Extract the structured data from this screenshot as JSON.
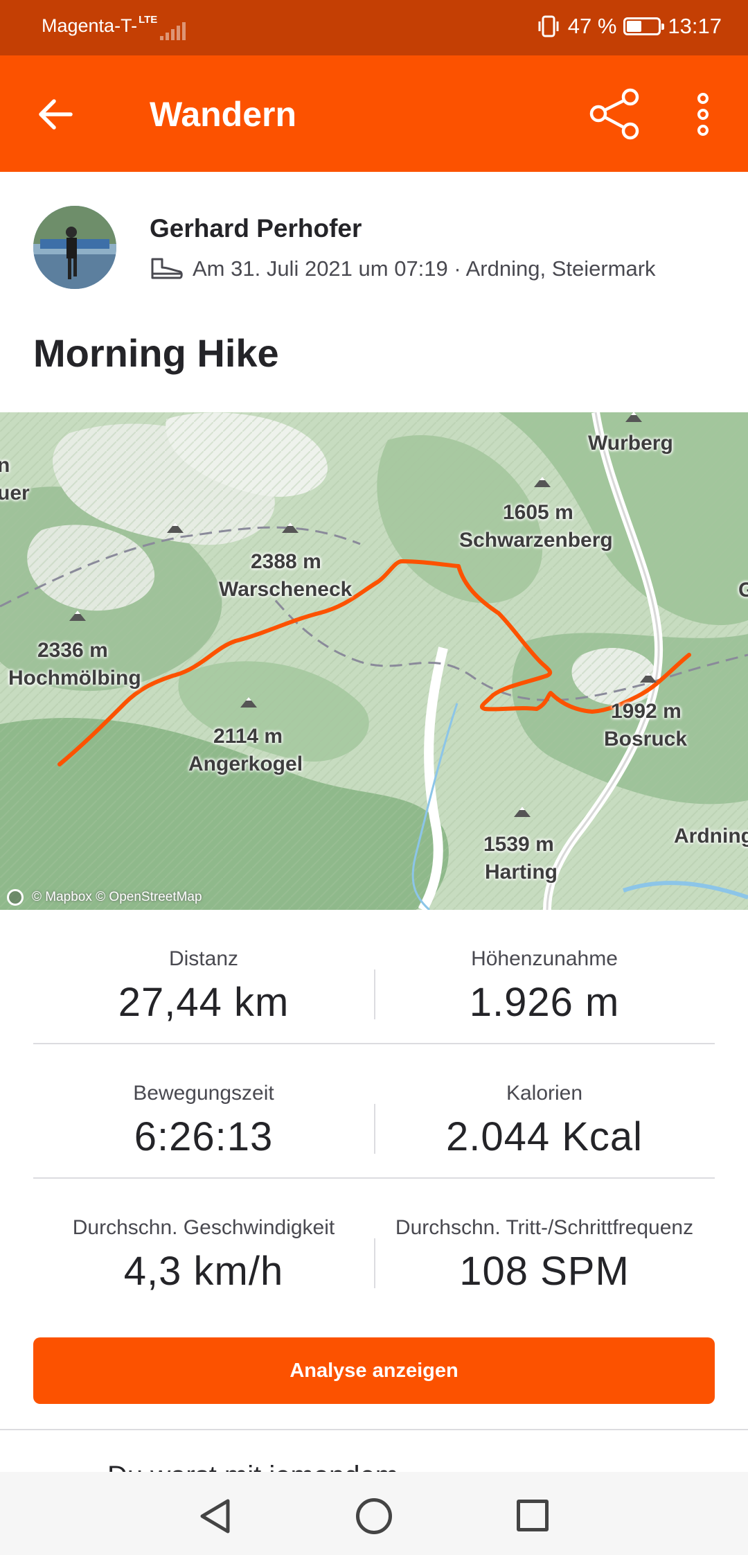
{
  "status_bar": {
    "carrier": "Magenta-T-",
    "network": "LTE",
    "battery_text": "47 %",
    "battery_level": 0.47,
    "time": "13:17"
  },
  "app_bar": {
    "title": "Wandern",
    "back_icon": "arrow-left-icon",
    "share_icon": "share-icon",
    "more_icon": "more-vertical-icon"
  },
  "activity": {
    "athlete_name": "Gerhard Perhofer",
    "activity_icon": "hiking-shoe-icon",
    "datetime_location": "Am 31. Juli 2021 um 07:19 · Ardning, Steiermark",
    "title": "Morning Hike"
  },
  "map": {
    "labels": {
      "wurberg": "Wurberg",
      "schwarzenberg_elev": "1605 m",
      "schwarzenberg": "Schwarzenberg",
      "warscheneck_elev": "2388 m",
      "warscheneck": "Warscheneck",
      "hochmoelbing_elev": "2336 m",
      "hochmoelbing": "Hochmölbing",
      "angerkogel_elev": "2114 m",
      "angerkogel": "Angerkogel",
      "bosruck_elev": "1992 m",
      "bosruck": "Bosruck",
      "harting_elev": "1539 m",
      "harting": "Harting",
      "ardning": "Ardning",
      "edge_left_1": "n",
      "edge_left_2": "uer",
      "edge_right": "G"
    },
    "attribution": "© Mapbox © OpenStreetMap",
    "route_color": "#fc5200"
  },
  "stats": [
    {
      "label": "Distanz",
      "value": "27,44 km"
    },
    {
      "label": "Höhenzunahme",
      "value": "1.926 m"
    },
    {
      "label": "Bewegungszeit",
      "value": "6:26:13"
    },
    {
      "label": "Kalorien",
      "value": "2.044 Kcal"
    },
    {
      "label": "Durchschn. Geschwindigkeit",
      "value": "4,3 km/h"
    },
    {
      "label": "Durchschn. Tritt-/Schrittfrequenz",
      "value": "108 SPM"
    }
  ],
  "analyse_button": "Analyse anzeigen",
  "cutoff_text": "Du warst mit jemandem",
  "colors": {
    "accent": "#fc5200",
    "status_bar": "#c43f04"
  }
}
